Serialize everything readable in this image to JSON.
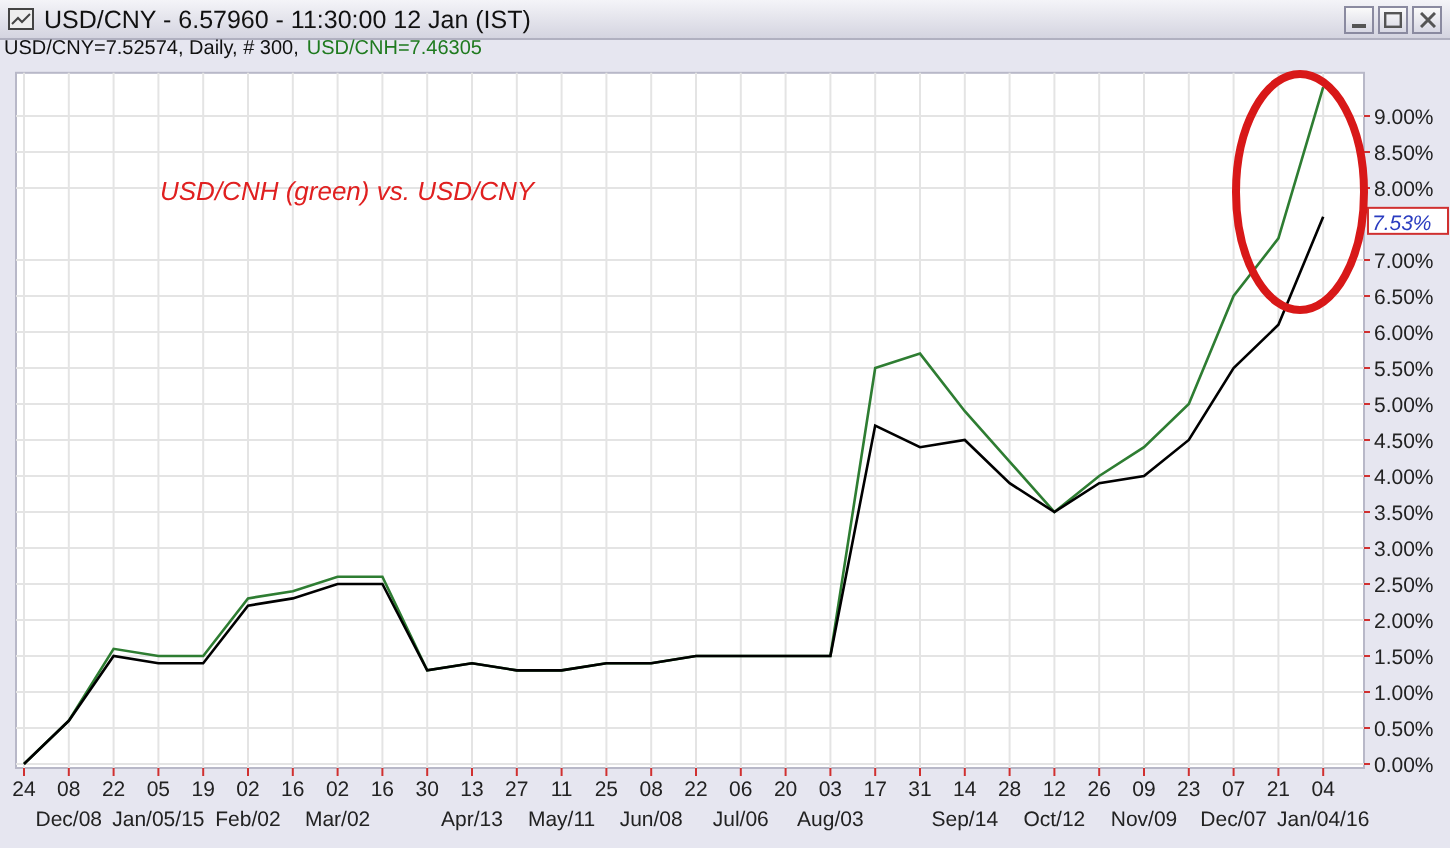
{
  "window": {
    "title": "USD/CNY - 6.57960 - 11:30:00  12 Jan (IST)",
    "buttons": [
      {
        "kind": "minimize"
      },
      {
        "kind": "maximize"
      },
      {
        "kind": "close"
      }
    ]
  },
  "info": {
    "primary": "USD/CNY=7.52574, Daily, # 300,",
    "secondary": "USD/CNH=7.46305"
  },
  "chart": {
    "chart_data": {
      "type": "line",
      "categories": [
        "24",
        "08 Dec/08",
        "22",
        "05 Jan/05/15",
        "19",
        "02 Feb/02",
        "16",
        "02 Mar/02",
        "16",
        "30",
        "13 Apr/13",
        "27",
        "11 May/11",
        "25",
        "08 Jun/08",
        "22",
        "06 Jul/06",
        "20",
        "03 Aug/03",
        "17",
        "31",
        "14 Sep/14",
        "28",
        "12 Oct/12",
        "26",
        "09 Nov/09",
        "23",
        "07 Dec/07",
        "21",
        "04 Jan/04/16"
      ],
      "series": [
        {
          "color": "#000000",
          "values": [
            0.0,
            0.6,
            1.5,
            1.4,
            1.4,
            2.2,
            2.3,
            2.5,
            2.5,
            1.3,
            1.4,
            1.3,
            1.3,
            1.4,
            1.4,
            1.5,
            1.5,
            1.5,
            1.5,
            4.7,
            4.4,
            4.5,
            3.9,
            3.5,
            3.9,
            4.0,
            4.5,
            5.5,
            6.1,
            7.6
          ]
        },
        {
          "color": "#2e7d32",
          "values": [
            0.0,
            0.6,
            1.6,
            1.5,
            1.5,
            2.3,
            2.4,
            2.6,
            2.6,
            1.3,
            1.4,
            1.3,
            1.3,
            1.4,
            1.4,
            1.5,
            1.5,
            1.5,
            1.5,
            5.5,
            5.7,
            4.9,
            4.2,
            3.5,
            4.0,
            4.4,
            5.0,
            6.5,
            7.3,
            9.4
          ]
        }
      ],
      "ylim": [
        0,
        9.6
      ],
      "grid": true,
      "yticks": [
        {
          "value": 0,
          "label": "0.00%"
        },
        {
          "value": 0.5,
          "label": "0.50%"
        },
        {
          "value": 1,
          "label": "1.00%"
        },
        {
          "value": 1.5,
          "label": "1.50%"
        },
        {
          "value": 2,
          "label": "2.00%"
        },
        {
          "value": 2.5,
          "label": "2.50%"
        },
        {
          "value": 3,
          "label": "3.00%"
        },
        {
          "value": 3.5,
          "label": "3.50%"
        },
        {
          "value": 4,
          "label": "4.00%"
        },
        {
          "value": 4.5,
          "label": "4.50%"
        },
        {
          "value": 5,
          "label": "5.00%"
        },
        {
          "value": 5.5,
          "label": "5.50%"
        },
        {
          "value": 6,
          "label": "6.00%"
        },
        {
          "value": 6.5,
          "label": "6.50%"
        },
        {
          "value": 7,
          "label": "7.00%"
        },
        {
          "value": 8,
          "label": "8.00%"
        },
        {
          "value": 8.5,
          "label": "8.50%"
        },
        {
          "value": 9,
          "label": "9.00%"
        }
      ],
      "annotations": [
        {
          "text": "USD/CNH (green) vs. USD/CNY"
        }
      ]
    },
    "last_value_label": "7.53%"
  }
}
